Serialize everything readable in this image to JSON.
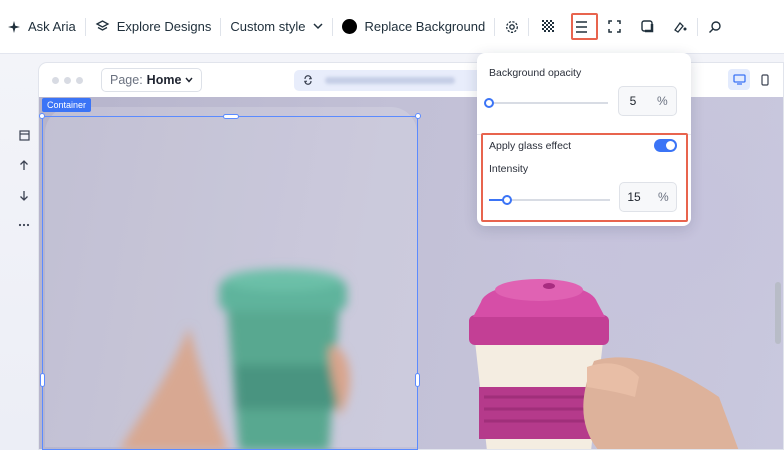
{
  "toolbar": {
    "ask_aria": "Ask Aria",
    "explore_designs": "Explore Designs",
    "custom_style": "Custom style",
    "replace_background": "Replace Background",
    "accent_color": "#e8644e"
  },
  "stage": {
    "page_prefix": "Page:",
    "page_name": "Home"
  },
  "selection": {
    "tag": "Container",
    "color": "#3b74f6"
  },
  "popover": {
    "bg_opacity_label": "Background opacity",
    "bg_opacity_value": "5",
    "bg_opacity_unit": "%",
    "glass_label": "Apply glass effect",
    "glass_enabled": true,
    "intensity_label": "Intensity",
    "intensity_value": "15",
    "intensity_unit": "%"
  },
  "icons": {
    "toolbar": [
      "sparkle-icon",
      "layers-icon",
      "chevron-down-icon",
      "color-swatch-icon",
      "settings-icon",
      "opacity-pattern-icon",
      "align-icon",
      "crop-icon",
      "shadow-icon",
      "paint-icon",
      "search-icon"
    ],
    "left": [
      "container-icon",
      "arrow-up-icon",
      "arrow-down-icon",
      "more-icon"
    ],
    "stage": [
      "refresh-icon",
      "desktop-icon",
      "mobile-icon"
    ]
  }
}
